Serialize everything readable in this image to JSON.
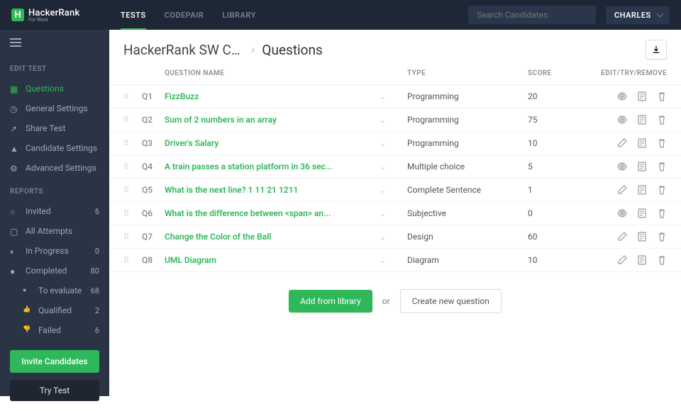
{
  "topbar": {
    "logo_text": "HackerRank",
    "logo_sub": "For Work",
    "logo_initial": "H",
    "tabs": [
      "TESTS",
      "CODEPAIR",
      "LIBRARY"
    ],
    "active_tab": 0,
    "search_placeholder": "Search Candidates",
    "user": "CHARLES"
  },
  "sidebar": {
    "edit_heading": "EDIT TEST",
    "edit_items": [
      {
        "label": "Questions",
        "active": true
      },
      {
        "label": "General Settings"
      },
      {
        "label": "Share Test"
      },
      {
        "label": "Candidate Settings"
      },
      {
        "label": "Advanced Settings"
      }
    ],
    "reports_heading": "REPORTS",
    "report_items": [
      {
        "label": "Invited",
        "count": "6"
      },
      {
        "label": "All Attempts",
        "count": ""
      },
      {
        "label": "In Progress",
        "count": "0"
      },
      {
        "label": "Completed",
        "count": "80"
      }
    ],
    "report_subs": [
      {
        "label": "To evaluate",
        "count": "68"
      },
      {
        "label": "Qualified",
        "count": "2"
      },
      {
        "label": "Failed",
        "count": "6"
      }
    ],
    "invite_label": "Invite Candidates",
    "try_label": "Try Test"
  },
  "breadcrumb": {
    "test_name": "HackerRank SW Chal...",
    "current": "Questions"
  },
  "table": {
    "headers": {
      "name": "QUESTION NAME",
      "type": "TYPE",
      "score": "SCORE",
      "actions": "EDIT/TRY/REMOVE"
    },
    "rows": [
      {
        "num": "Q1",
        "name": "FizzBuzz",
        "type": "Programming",
        "score": "20",
        "first_icon": "eye"
      },
      {
        "num": "Q2",
        "name": "Sum of 2 numbers in an array",
        "type": "Programming",
        "score": "75",
        "first_icon": "eye"
      },
      {
        "num": "Q3",
        "name": "Driver's Salary",
        "type": "Programming",
        "score": "10",
        "first_icon": "edit"
      },
      {
        "num": "Q4",
        "name": "A train passes a station platform in 36 sec...",
        "type": "Multiple choice",
        "score": "5",
        "first_icon": "eye"
      },
      {
        "num": "Q5",
        "name": "What is the next line? 1 11 21 1211",
        "type": "Complete Sentence",
        "score": "1",
        "first_icon": "edit"
      },
      {
        "num": "Q6",
        "name": "What is the difference between <span> an...",
        "type": "Subjective",
        "score": "0",
        "first_icon": "eye"
      },
      {
        "num": "Q7",
        "name": "Change the Color of the Ball",
        "type": "Design",
        "score": "60",
        "first_icon": "edit"
      },
      {
        "num": "Q8",
        "name": "UML Diagram",
        "type": "Diagram",
        "score": "10",
        "first_icon": "edit"
      }
    ]
  },
  "buttons": {
    "add_library": "Add from library",
    "or": "or",
    "create_new": "Create new question"
  }
}
